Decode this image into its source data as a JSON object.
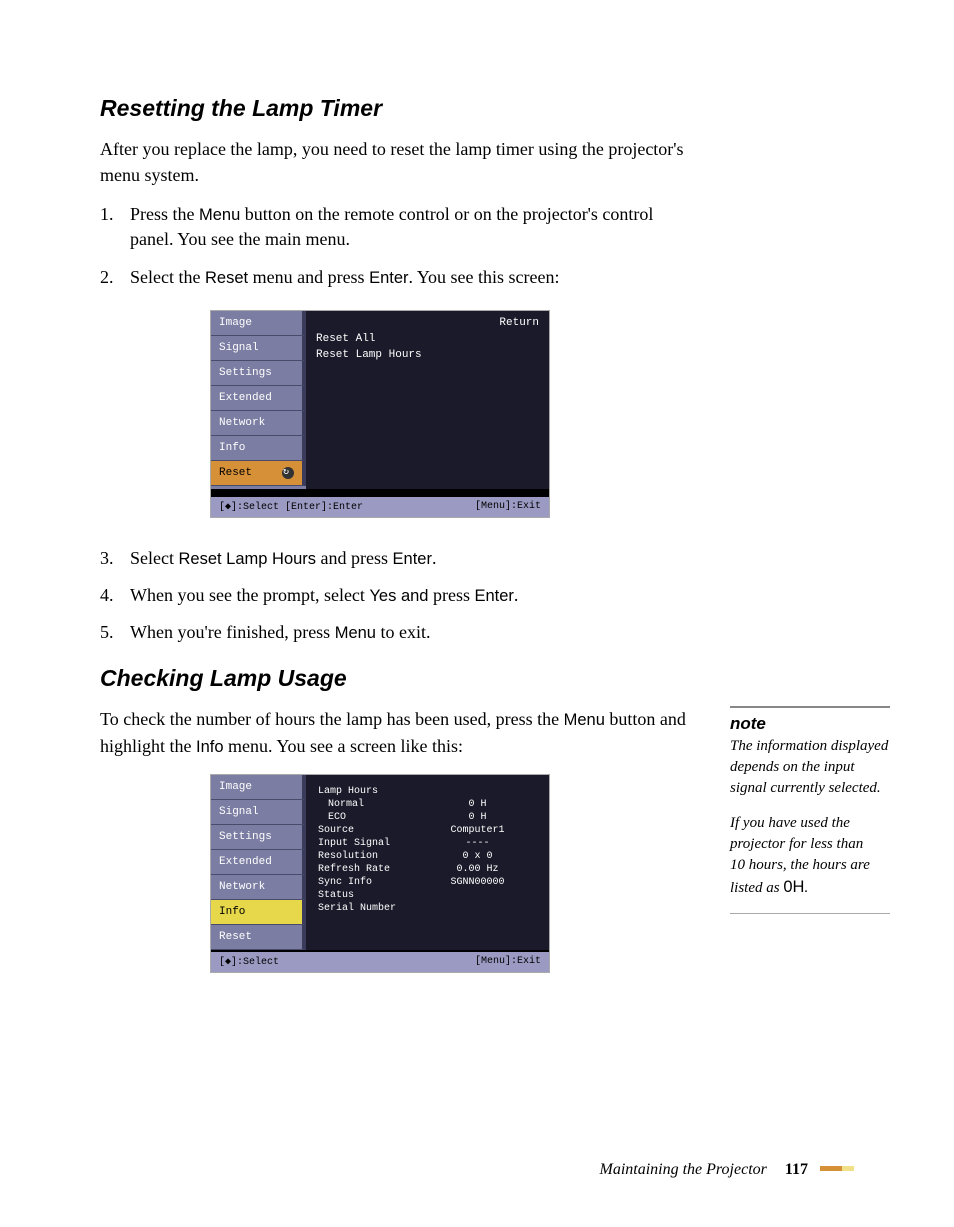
{
  "section1": {
    "heading": "Resetting the Lamp Timer",
    "intro_before": "After you replace the lamp, you need to reset the lamp timer using the projector's menu system.",
    "step1_num": "1.",
    "step1_a": "Press the ",
    "step1_kw": "Menu",
    "step1_b": " button on the remote control or on the projector's control panel. You see the main menu.",
    "step2_num": "2.",
    "step2_a": "Select the ",
    "step2_kw1": "Reset",
    "step2_b": " menu and press ",
    "step2_kw2": "Enter",
    "step2_c": ". You see this screen:",
    "step3_num": "3.",
    "step3_a": "Select ",
    "step3_kw1": "Reset Lamp Hours",
    "step3_b": " and press ",
    "step3_kw2": "Enter",
    "step3_c": ".",
    "step4_num": "4.",
    "step4_a": "When you see the prompt, select ",
    "step4_kw1": "Yes and",
    "step4_b": " press ",
    "step4_kw2": "Enter",
    "step4_c": ".",
    "step5_num": "5.",
    "step5_a": "When you're finished, press ",
    "step5_kw1": "Menu",
    "step5_b": " to exit."
  },
  "menu1": {
    "side": {
      "image": "Image",
      "signal": "Signal",
      "settings": "Settings",
      "extended": "Extended",
      "network": "Network",
      "info": "Info",
      "reset": "Reset"
    },
    "return": "Return",
    "opt1": "Reset All",
    "opt2": "Reset Lamp Hours",
    "footer_left": "[◆]:Select [Enter]:Enter",
    "footer_right": "[Menu]:Exit"
  },
  "section2": {
    "heading": "Checking Lamp Usage",
    "intro_a": "To check the number of hours the lamp has been used, press the ",
    "intro_kw1": "Menu",
    "intro_b": " button and highlight the ",
    "intro_kw2": "Info",
    "intro_c": " menu. You see a screen like this:"
  },
  "menu2": {
    "side": {
      "image": "Image",
      "signal": "Signal",
      "settings": "Settings",
      "extended": "Extended",
      "network": "Network",
      "info": "Info",
      "reset": "Reset"
    },
    "rows": [
      {
        "lbl": "Lamp Hours",
        "val": ""
      },
      {
        "lbl": "Normal",
        "val": "0 H"
      },
      {
        "lbl": "ECO",
        "val": "0 H"
      },
      {
        "lbl": "Source",
        "val": "Computer1"
      },
      {
        "lbl": "Input Signal",
        "val": "----"
      },
      {
        "lbl": "Resolution",
        "val": "0 x    0"
      },
      {
        "lbl": "Refresh Rate",
        "val": "0.00 Hz"
      },
      {
        "lbl": "Sync Info",
        "val": "SGNN00000"
      },
      {
        "lbl": "Status",
        "val": ""
      },
      {
        "lbl": "Serial Number",
        "val": ""
      }
    ],
    "footer_left": "[◆]:Select",
    "footer_right": "[Menu]:Exit"
  },
  "note": {
    "head": "note",
    "body1": "The information displayed depends on the input signal currently selected.",
    "body2a": "If you have used the projector for less than 10 hours, the hours are listed as ",
    "body2_kw": "0H",
    "body2b": "."
  },
  "footer": {
    "title": "Maintaining the Projector",
    "page": "117"
  }
}
